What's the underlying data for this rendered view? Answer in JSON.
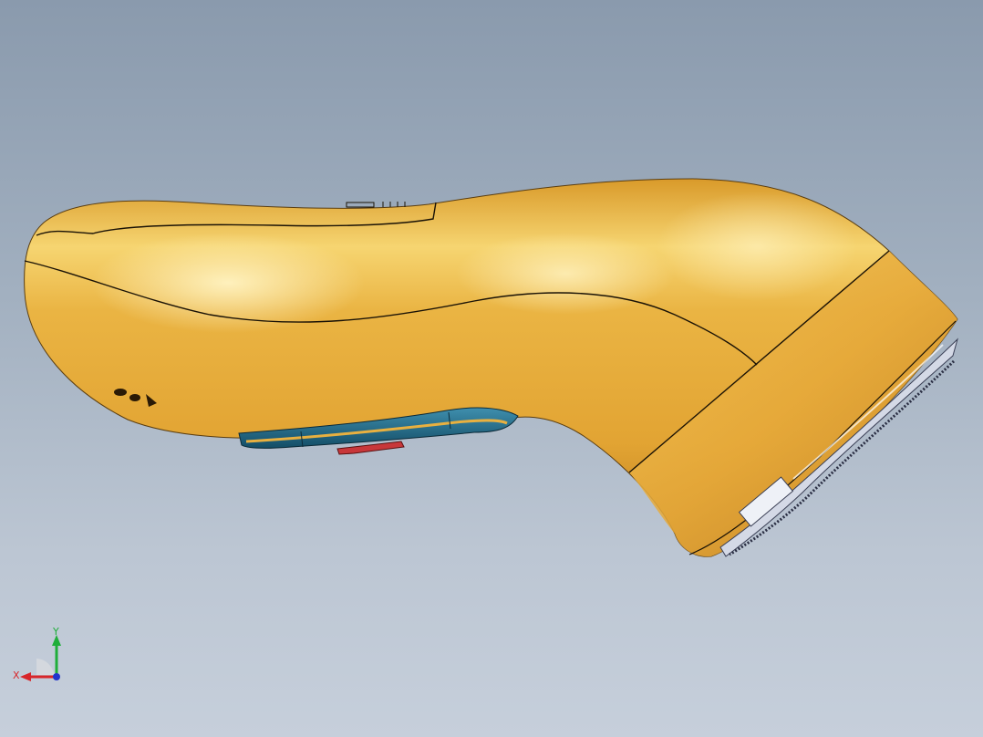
{
  "viewport": {
    "background_top": "#8a9aad",
    "background_bottom": "#c6cfdb"
  },
  "model": {
    "body_color": "#e3a836",
    "highlight_color": "#fbe8a0",
    "shadow_color": "#b8781c",
    "grip_color": "#1f6d8c",
    "button_color": "#c8373a",
    "blade_color": "#d4d9e6"
  },
  "triad": {
    "x_label": "X",
    "y_label": "Y",
    "x_color": "#d8262a",
    "y_color": "#1fae3a",
    "z_color": "#2233cc"
  }
}
